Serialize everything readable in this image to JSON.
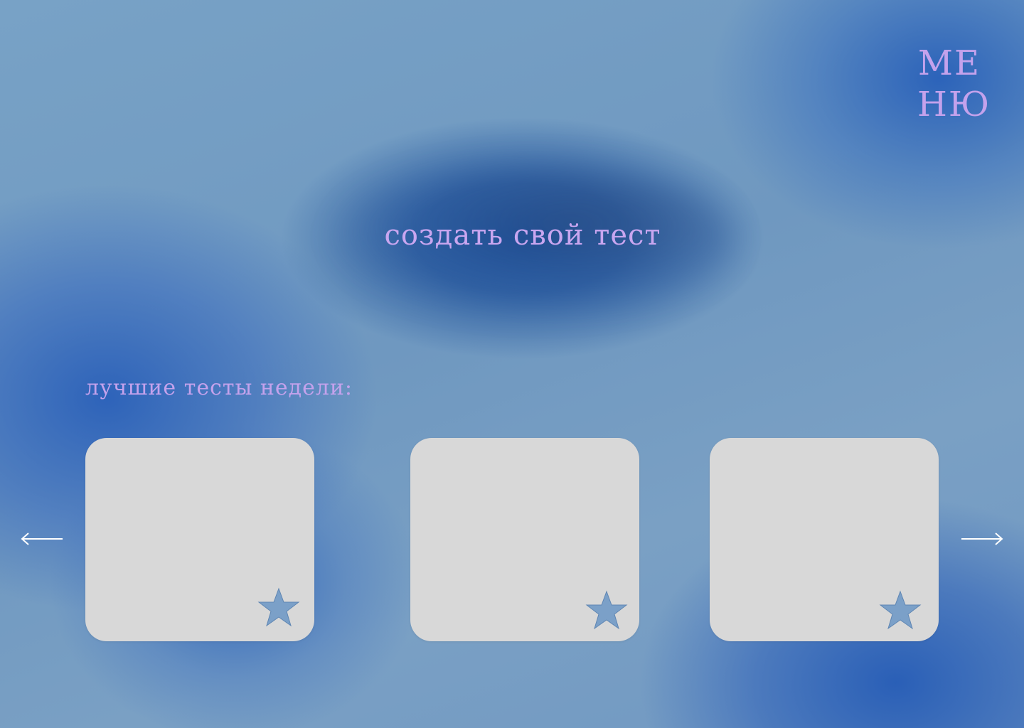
{
  "menu": {
    "line1": "МЕ",
    "line2": "НЮ"
  },
  "hero": {
    "create_label": "создать свой тест"
  },
  "best_tests": {
    "title": "лучшие тесты недели:",
    "cards": [
      {
        "favorite_icon": "star-icon"
      },
      {
        "favorite_icon": "star-icon"
      },
      {
        "favorite_icon": "star-icon"
      }
    ]
  },
  "carousel": {
    "prev_icon": "arrow-left-icon",
    "next_icon": "arrow-right-icon"
  },
  "colors": {
    "accent_text": "#c4a2ec",
    "card_bg": "#d8d8d8",
    "star_fill": "#7ba0c8",
    "arrow": "#ffffff"
  }
}
